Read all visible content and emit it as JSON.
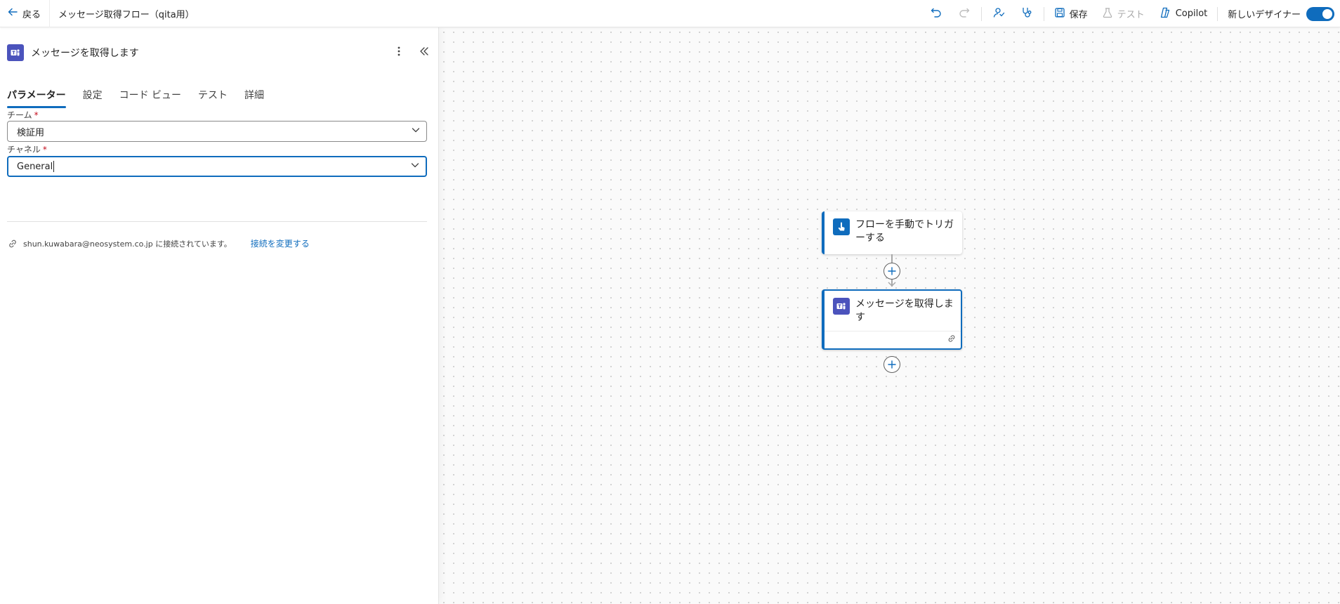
{
  "topbar": {
    "back_label": "戻る",
    "flow_title": "メッセージ取得フロー（qita用）",
    "save_label": "保存",
    "test_label": "テスト",
    "copilot_label": "Copilot",
    "new_designer_label": "新しいデザイナー",
    "new_designer_on": true
  },
  "panel": {
    "title": "メッセージを取得します",
    "tabs": [
      {
        "label": "パラメーター",
        "active": true
      },
      {
        "label": "設定",
        "active": false
      },
      {
        "label": "コード ビュー",
        "active": false
      },
      {
        "label": "テスト",
        "active": false
      },
      {
        "label": "詳細",
        "active": false
      }
    ],
    "team_label": "チーム",
    "team_value": "検証用",
    "channel_label": "チャネル",
    "channel_value": "General",
    "required_mark": "*",
    "connection_text": "shun.kuwabara@neosystem.co.jp に接続されています。",
    "change_connection_label": "接続を変更する"
  },
  "canvas": {
    "trigger_card_title": "フローを手動でトリガーする",
    "action_card_title": "メッセージを取得します"
  },
  "colors": {
    "accent": "#0f6cbd",
    "teams": "#4b53bc"
  }
}
